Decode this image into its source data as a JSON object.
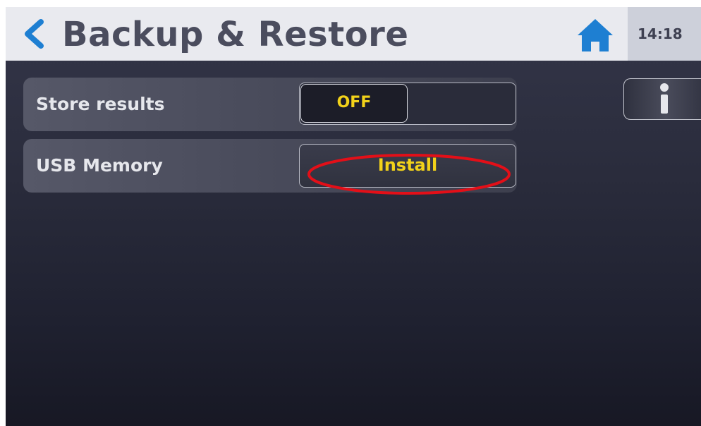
{
  "header": {
    "title": "Backup & Restore",
    "time": "14:18",
    "back_icon": "chevron-left-icon",
    "home_icon": "home-icon"
  },
  "settings": [
    {
      "label": "Store results",
      "control": "toggle",
      "value": "OFF"
    },
    {
      "label": "USB Memory",
      "control": "button",
      "value": "Install"
    }
  ],
  "info_button": {
    "icon": "info-icon"
  },
  "annotation": {
    "highlight": "red-ellipse",
    "color": "#e30f18"
  },
  "colors": {
    "accent_blue": "#1e7fd2",
    "value_yellow": "#f2d21a",
    "header_bg": "#e9eaef"
  }
}
